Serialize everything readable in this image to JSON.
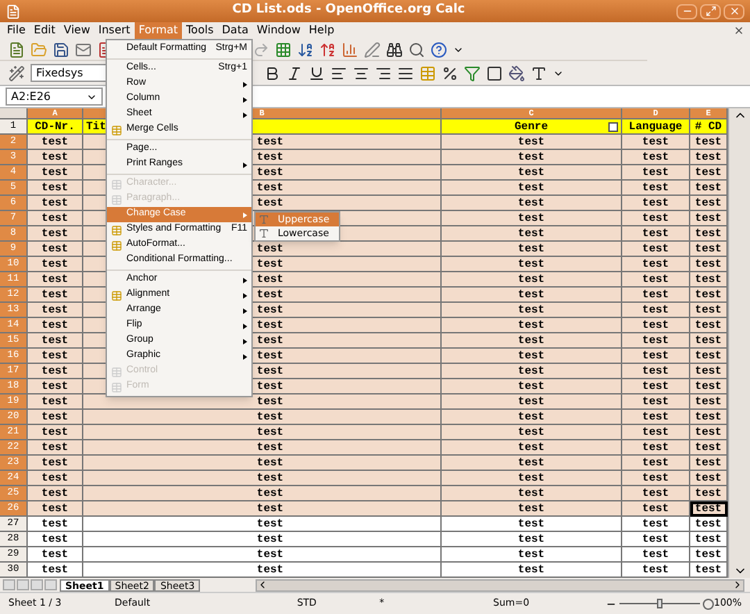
{
  "window": {
    "title": "CD List.ods - OpenOffice.org Calc"
  },
  "menubar": [
    {
      "label": "File",
      "selected": false
    },
    {
      "label": "Edit",
      "selected": false
    },
    {
      "label": "View",
      "selected": false
    },
    {
      "label": "Insert",
      "selected": false
    },
    {
      "label": "Format",
      "selected": true
    },
    {
      "label": "Tools",
      "selected": false
    },
    {
      "label": "Data",
      "selected": false
    },
    {
      "label": "Window",
      "selected": false
    },
    {
      "label": "Help",
      "selected": false
    }
  ],
  "font_field": {
    "value": "Fixedsys"
  },
  "name_box": {
    "value": "A2:E26"
  },
  "columns": [
    {
      "label": "A"
    },
    {
      "label": "B"
    },
    {
      "label": "C"
    },
    {
      "label": "D"
    },
    {
      "label": "E"
    }
  ],
  "header_row": {
    "number": "1",
    "cells": [
      "CD-Nr.",
      "Tit",
      "Genre",
      "Language",
      "# CD"
    ]
  },
  "rows": [
    {
      "number": "2",
      "selected": true,
      "cells": [
        "test",
        "test",
        "test",
        "test",
        "test"
      ]
    },
    {
      "number": "3",
      "selected": true,
      "cells": [
        "test",
        "test",
        "test",
        "test",
        "test"
      ]
    },
    {
      "number": "4",
      "selected": true,
      "cells": [
        "test",
        "test",
        "test",
        "test",
        "test"
      ]
    },
    {
      "number": "5",
      "selected": true,
      "cells": [
        "test",
        "test",
        "test",
        "test",
        "test"
      ]
    },
    {
      "number": "6",
      "selected": true,
      "cells": [
        "test",
        "test",
        "test",
        "test",
        "test"
      ]
    },
    {
      "number": "7",
      "selected": true,
      "cells": [
        "test",
        null,
        "test",
        "test",
        "test"
      ]
    },
    {
      "number": "8",
      "selected": true,
      "cells": [
        "test",
        null,
        "test",
        "test",
        "test"
      ]
    },
    {
      "number": "9",
      "selected": true,
      "cells": [
        "test",
        "test",
        "test",
        "test",
        "test"
      ]
    },
    {
      "number": "10",
      "selected": true,
      "cells": [
        "test",
        "test",
        "test",
        "test",
        "test"
      ]
    },
    {
      "number": "11",
      "selected": true,
      "cells": [
        "test",
        "test",
        "test",
        "test",
        "test"
      ]
    },
    {
      "number": "12",
      "selected": true,
      "cells": [
        "test",
        "test",
        "test",
        "test",
        "test"
      ]
    },
    {
      "number": "13",
      "selected": true,
      "cells": [
        "test",
        "test",
        "test",
        "test",
        "test"
      ]
    },
    {
      "number": "14",
      "selected": true,
      "cells": [
        "test",
        "test",
        "test",
        "test",
        "test"
      ]
    },
    {
      "number": "15",
      "selected": true,
      "cells": [
        "test",
        "test",
        "test",
        "test",
        "test"
      ]
    },
    {
      "number": "16",
      "selected": true,
      "cells": [
        "test",
        "test",
        "test",
        "test",
        "test"
      ]
    },
    {
      "number": "17",
      "selected": true,
      "cells": [
        "test",
        "test",
        "test",
        "test",
        "test"
      ]
    },
    {
      "number": "18",
      "selected": true,
      "cells": [
        "test",
        "test",
        "test",
        "test",
        "test"
      ]
    },
    {
      "number": "19",
      "selected": true,
      "cells": [
        "test",
        "test",
        "test",
        "test",
        "test"
      ]
    },
    {
      "number": "20",
      "selected": true,
      "cells": [
        "test",
        "test",
        "test",
        "test",
        "test"
      ]
    },
    {
      "number": "21",
      "selected": true,
      "cells": [
        "test",
        "test",
        "test",
        "test",
        "test"
      ]
    },
    {
      "number": "22",
      "selected": true,
      "cells": [
        "test",
        "test",
        "test",
        "test",
        "test"
      ]
    },
    {
      "number": "23",
      "selected": true,
      "cells": [
        "test",
        "test",
        "test",
        "test",
        "test"
      ]
    },
    {
      "number": "24",
      "selected": true,
      "cells": [
        "test",
        "test",
        "test",
        "test",
        "test"
      ]
    },
    {
      "number": "25",
      "selected": true,
      "cells": [
        "test",
        "test",
        "test",
        "test",
        "test"
      ]
    },
    {
      "number": "26",
      "selected": true,
      "cells": [
        "test",
        "test",
        "test",
        "test",
        "test"
      ]
    },
    {
      "number": "27",
      "selected": false,
      "cells": [
        "test",
        "test",
        "test",
        "test",
        "test"
      ]
    },
    {
      "number": "28",
      "selected": false,
      "cells": [
        "test",
        "test",
        "test",
        "test",
        "test"
      ]
    },
    {
      "number": "29",
      "selected": false,
      "cells": [
        "test",
        "test",
        "test",
        "test",
        "test"
      ]
    },
    {
      "number": "30",
      "selected": false,
      "cells": [
        "test",
        "test",
        "test",
        "test",
        "test"
      ]
    }
  ],
  "format_menu": [
    {
      "kind": "item",
      "label": "Default Formatting",
      "shortcut": "Strg+M",
      "submenu": false,
      "disabled": false,
      "selected": false,
      "has_icon": false
    },
    {
      "kind": "separator"
    },
    {
      "kind": "item",
      "label": "Cells...",
      "shortcut": "Strg+1",
      "submenu": false,
      "disabled": false,
      "selected": false,
      "has_icon": false
    },
    {
      "kind": "item",
      "label": "Row",
      "submenu": true,
      "disabled": false,
      "selected": false,
      "has_icon": false
    },
    {
      "kind": "item",
      "label": "Column",
      "submenu": true,
      "disabled": false,
      "selected": false,
      "has_icon": false
    },
    {
      "kind": "item",
      "label": "Sheet",
      "submenu": true,
      "disabled": false,
      "selected": false,
      "has_icon": false
    },
    {
      "kind": "item",
      "label": "Merge Cells",
      "submenu": false,
      "disabled": false,
      "selected": false,
      "has_icon": true
    },
    {
      "kind": "separator"
    },
    {
      "kind": "item",
      "label": "Page...",
      "submenu": false,
      "disabled": false,
      "selected": false,
      "has_icon": false
    },
    {
      "kind": "item",
      "label": "Print Ranges",
      "submenu": true,
      "disabled": false,
      "selected": false,
      "has_icon": false
    },
    {
      "kind": "separator"
    },
    {
      "kind": "item",
      "label": "Character...",
      "submenu": false,
      "disabled": true,
      "selected": false,
      "has_icon": true
    },
    {
      "kind": "item",
      "label": "Paragraph...",
      "submenu": false,
      "disabled": true,
      "selected": false,
      "has_icon": true
    },
    {
      "kind": "item",
      "label": "Change Case",
      "submenu": true,
      "disabled": false,
      "selected": true,
      "has_icon": false
    },
    {
      "kind": "item",
      "label": "Styles and Formatting",
      "shortcut": "F11",
      "submenu": false,
      "disabled": false,
      "selected": false,
      "has_icon": true
    },
    {
      "kind": "item",
      "label": "AutoFormat...",
      "submenu": false,
      "disabled": false,
      "selected": false,
      "has_icon": true
    },
    {
      "kind": "item",
      "label": "Conditional Formatting...",
      "submenu": false,
      "disabled": false,
      "selected": false,
      "has_icon": false
    },
    {
      "kind": "separator"
    },
    {
      "kind": "item",
      "label": "Anchor",
      "submenu": true,
      "disabled": false,
      "selected": false,
      "has_icon": false
    },
    {
      "kind": "item",
      "label": "Alignment",
      "submenu": true,
      "disabled": false,
      "selected": false,
      "has_icon": true
    },
    {
      "kind": "item",
      "label": "Arrange",
      "submenu": true,
      "disabled": false,
      "selected": false,
      "has_icon": false
    },
    {
      "kind": "item",
      "label": "Flip",
      "submenu": true,
      "disabled": false,
      "selected": false,
      "has_icon": false
    },
    {
      "kind": "item",
      "label": "Group",
      "submenu": true,
      "disabled": false,
      "selected": false,
      "has_icon": false
    },
    {
      "kind": "item",
      "label": "Graphic",
      "submenu": true,
      "disabled": false,
      "selected": false,
      "has_icon": false
    },
    {
      "kind": "item",
      "label": "Control",
      "submenu": false,
      "disabled": true,
      "selected": false,
      "has_icon": true
    },
    {
      "kind": "item",
      "label": "Form",
      "submenu": false,
      "disabled": true,
      "selected": false,
      "has_icon": true
    }
  ],
  "change_case_menu": [
    {
      "label": "Uppercase",
      "selected": true
    },
    {
      "label": "Lowercase",
      "selected": false
    }
  ],
  "sheet_tabs": [
    {
      "label": "Sheet1",
      "selected": true
    },
    {
      "label": "Sheet2",
      "selected": false
    },
    {
      "label": "Sheet3",
      "selected": false
    }
  ],
  "status_bar": {
    "sheet": "Sheet 1 / 3",
    "style": "Default",
    "mode": "STD",
    "modified": "*",
    "sum": "Sum=0",
    "zoom": "100%",
    "zoom_slider": {
      "level": 0.5
    }
  }
}
